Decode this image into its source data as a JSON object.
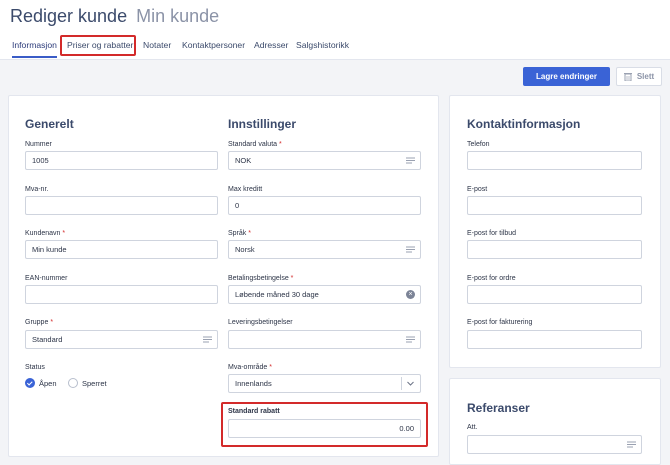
{
  "header": {
    "title": "Rediger kunde",
    "subtitle": "Min kunde",
    "tabs": [
      "Informasjon",
      "Priser og rabatter",
      "Notater",
      "Kontaktpersoner",
      "Adresser",
      "Salgshistorikk"
    ]
  },
  "toolbar": {
    "save_label": "Lagre endringer",
    "delete_label": "Slett"
  },
  "general": {
    "heading": "Generelt",
    "number_label": "Nummer",
    "number_value": "1005",
    "vat_label": "Mva-nr.",
    "vat_value": "",
    "name_label": "Kundenavn",
    "name_value": "Min kunde",
    "ean_label": "EAN-nummer",
    "ean_value": "",
    "group_label": "Gruppe",
    "group_value": "Standard",
    "status_label": "Status",
    "status_open": "Åpen",
    "status_locked": "Sperret"
  },
  "settings": {
    "heading": "Innstillinger",
    "currency_label": "Standard valuta",
    "currency_value": "NOK",
    "credit_label": "Max kreditt",
    "credit_value": "0",
    "language_label": "Språk",
    "language_value": "Norsk",
    "payment_label": "Betalingsbetingelse",
    "payment_value": "Løbende måned 30 dage",
    "delivery_label": "Leveringsbetingelser",
    "delivery_value": "",
    "vatarea_label": "Mva-område",
    "vatarea_value": "Innenlands",
    "discount_label": "Standard rabatt",
    "discount_value": "0.00"
  },
  "contact": {
    "heading": "Kontaktinformasjon",
    "phone_label": "Telefon",
    "email_label": "E-post",
    "email_quote_label": "E-post for tilbud",
    "email_order_label": "E-post for ordre",
    "email_invoice_label": "E-post for fakturering"
  },
  "references": {
    "heading": "Referanser",
    "att_label": "Att."
  },
  "colors": {
    "accent": "#3a63d6",
    "highlight": "#d32a2a"
  },
  "required_mark": "*"
}
